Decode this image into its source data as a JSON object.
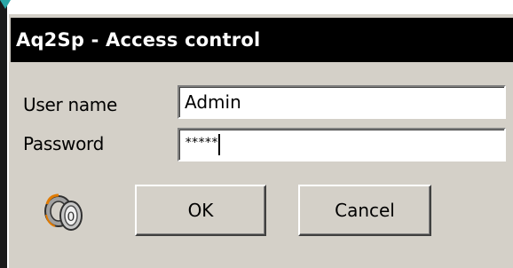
{
  "window": {
    "title": "Aq2Sp - Access control"
  },
  "form": {
    "username_label": "User name",
    "username_value": "Admin",
    "password_label": "Password",
    "password_value": "*****"
  },
  "buttons": {
    "ok_label": "OK",
    "cancel_label": "Cancel"
  },
  "icons": {
    "lock": "key-lock-icon"
  },
  "colors": {
    "titlebar_bg": "#000000",
    "titlebar_text": "#ffffff",
    "dialog_bg": "#d4d0c8",
    "field_bg": "#ffffff"
  }
}
